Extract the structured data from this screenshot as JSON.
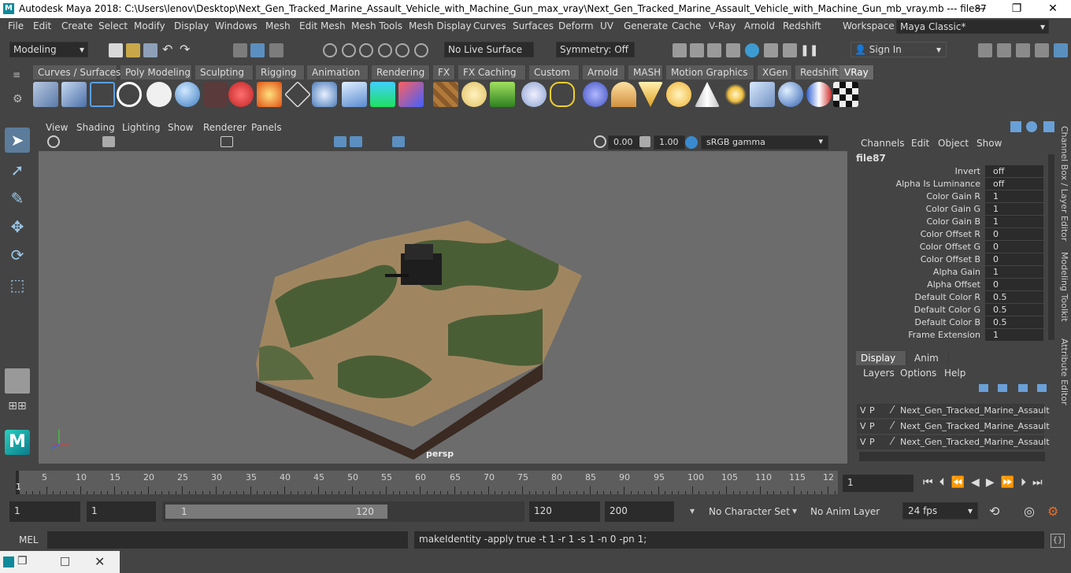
{
  "title_bar": {
    "logo": "M",
    "title": "Autodesk Maya 2018: C:\\Users\\lenov\\Desktop\\Next_Gen_Tracked_Marine_Assault_Vehicle_with_Machine_Gun_max_vray\\Next_Gen_Tracked_Marine_Assault_Vehicle_with_Machine_Gun_mb_vray.mb  ---  file87",
    "minimize": "—",
    "maximize": "❐",
    "close": "✕"
  },
  "menu": [
    "File",
    "Edit",
    "Create",
    "Select",
    "Modify",
    "Display",
    "Windows",
    "Mesh",
    "Edit Mesh",
    "Mesh Tools",
    "Mesh Display",
    "Curves",
    "Surfaces",
    "Deform",
    "UV",
    "Generate",
    "Cache",
    "V-Ray",
    "Arnold",
    "Redshift"
  ],
  "workspace": {
    "label": "Workspace :",
    "value": "Maya Classic*"
  },
  "status": {
    "mode": "Modeling",
    "live_surface": "No Live Surface",
    "symmetry": "Symmetry: Off",
    "sign_in": "Sign In"
  },
  "shelf_tabs": [
    "Curves / Surfaces",
    "Poly Modeling",
    "Sculpting",
    "Rigging",
    "Animation",
    "Rendering",
    "FX",
    "FX Caching",
    "Custom",
    "Arnold",
    "MASH",
    "Motion Graphics",
    "XGen",
    "Redshift",
    "VRay"
  ],
  "shelf_active": "VRay",
  "viewport": {
    "menu": [
      "View",
      "Shading",
      "Lighting",
      "Show",
      "Renderer",
      "Panels"
    ],
    "exposure": "0.00",
    "gamma": "1.00",
    "color_space": "sRGB gamma",
    "camera_label": "persp"
  },
  "channel_box": {
    "menu": [
      "Channels",
      "Edit",
      "Object",
      "Show"
    ],
    "node": "file87",
    "attributes": [
      {
        "label": "Invert",
        "value": "off"
      },
      {
        "label": "Alpha Is Luminance",
        "value": "off"
      },
      {
        "label": "Color Gain R",
        "value": "1"
      },
      {
        "label": "Color Gain G",
        "value": "1"
      },
      {
        "label": "Color Gain B",
        "value": "1"
      },
      {
        "label": "Color Offset R",
        "value": "0"
      },
      {
        "label": "Color Offset G",
        "value": "0"
      },
      {
        "label": "Color Offset B",
        "value": "0"
      },
      {
        "label": "Alpha Gain",
        "value": "1"
      },
      {
        "label": "Alpha Offset",
        "value": "0"
      },
      {
        "label": "Default Color R",
        "value": "0.5"
      },
      {
        "label": "Default Color G",
        "value": "0.5"
      },
      {
        "label": "Default Color B",
        "value": "0.5"
      },
      {
        "label": "Frame Extension",
        "value": "1"
      }
    ]
  },
  "side_tabs": [
    "Channel Box / Layer Editor",
    "Modeling Toolkit",
    "Attribute Editor"
  ],
  "layer_editor": {
    "tabs": [
      "Display",
      "Anim"
    ],
    "menu": [
      "Layers",
      "Options",
      "Help"
    ],
    "layers": [
      {
        "v": "V",
        "p": "P",
        "name": "Next_Gen_Tracked_Marine_Assault"
      },
      {
        "v": "V",
        "p": "P",
        "name": "Next_Gen_Tracked_Marine_Assault"
      },
      {
        "v": "V",
        "p": "P",
        "name": "Next_Gen_Tracked_Marine_Assault"
      }
    ]
  },
  "timeline": {
    "ticks": [
      "5",
      "10",
      "15",
      "20",
      "25",
      "30",
      "35",
      "40",
      "45",
      "50",
      "55",
      "60",
      "65",
      "70",
      "75",
      "80",
      "85",
      "90",
      "95",
      "100",
      "105",
      "110",
      "115",
      "12"
    ],
    "current_marker": "1",
    "current_frame": "1"
  },
  "range": {
    "start": "1",
    "playback_start": "1",
    "slider_start": "1",
    "slider_end": "120",
    "playback_end": "120",
    "end": "200",
    "character_set": "No Character Set",
    "anim_layer": "No Anim Layer",
    "fps": "24 fps"
  },
  "command": {
    "lang": "MEL",
    "output": "makeIdentity -apply true -t 1 -r 1 -s 1 -n 0 -pn 1;"
  }
}
